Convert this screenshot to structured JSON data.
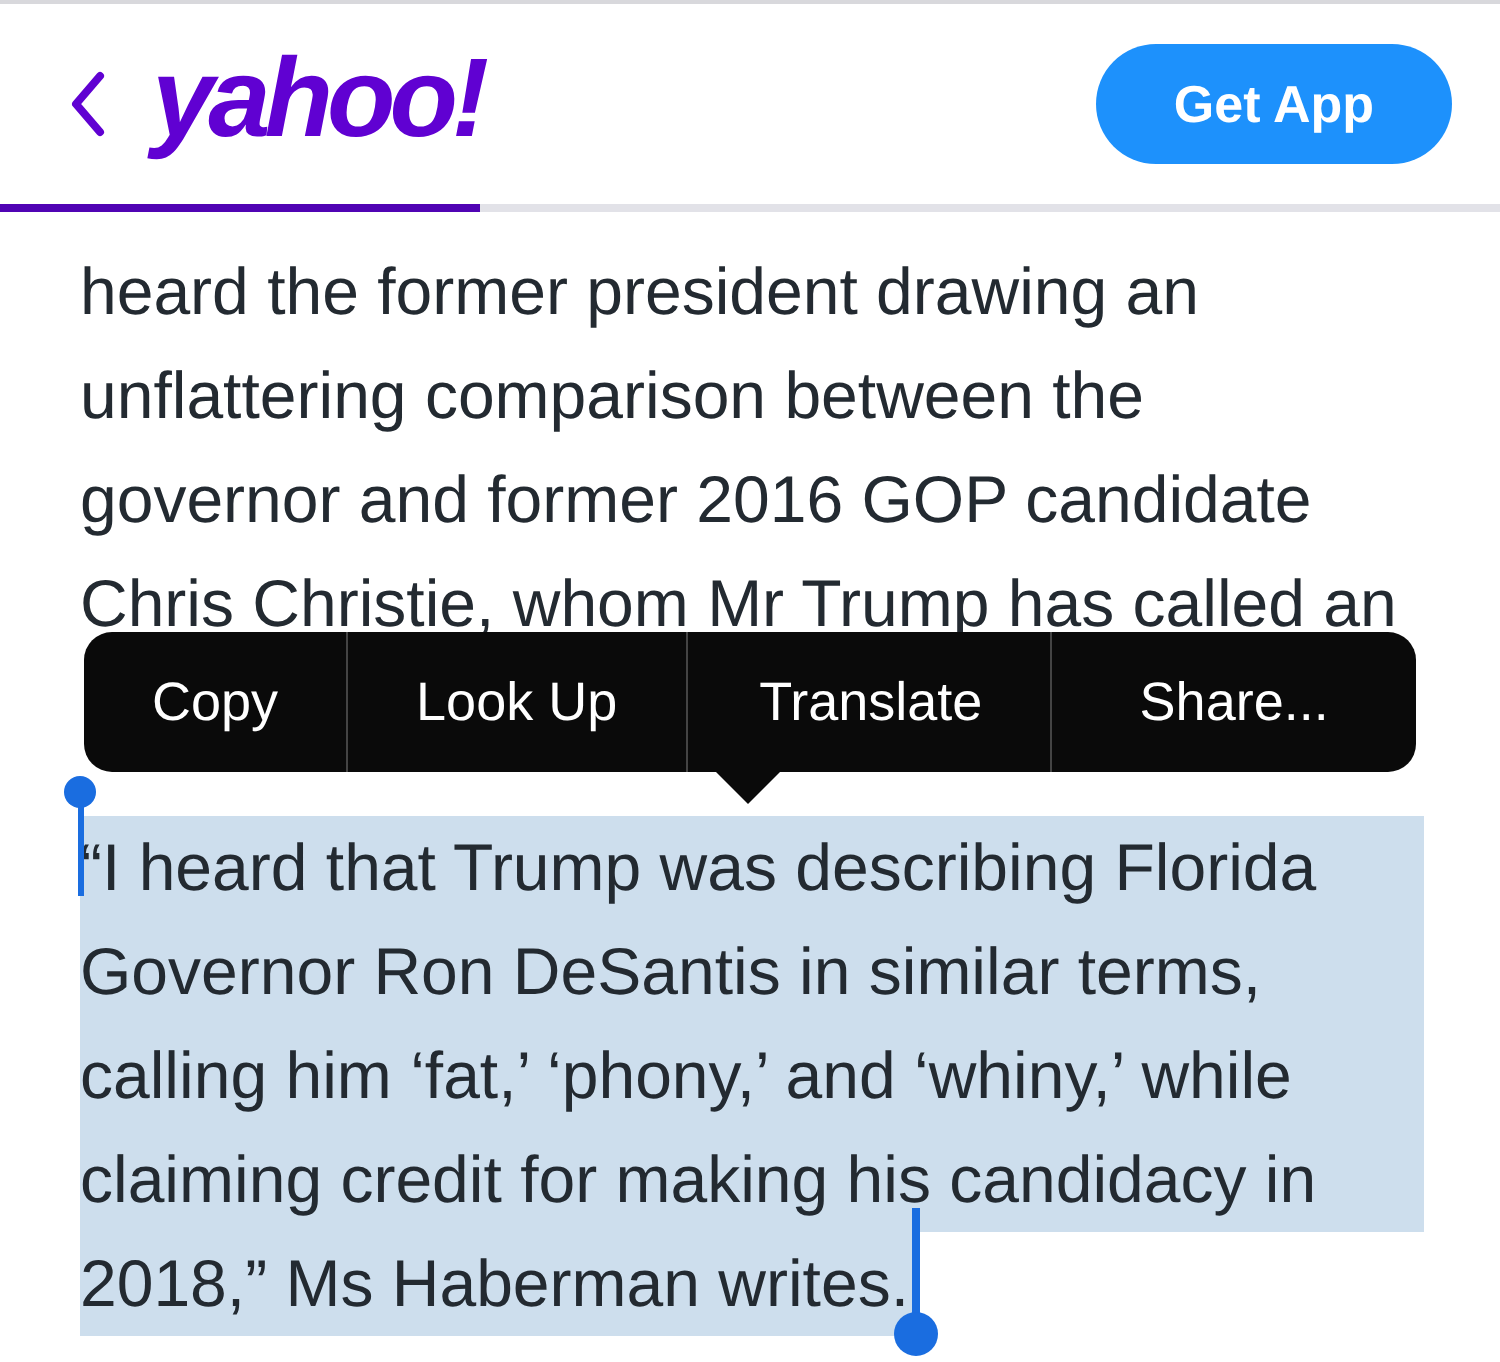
{
  "header": {
    "logo": "yahoo!",
    "button": "Get App"
  },
  "reading_progress": {
    "level": 0.32
  },
  "paragraphs": [
    {
      "text": "heard the former president drawing an unflattering comparison between the governor and former 2016 GOP candidate Chris Christie, whom Mr Trump has called an",
      "selected": false
    },
    {
      "text": "“I heard that Trump was describing Florida Governor Ron DeSantis in similar terms, calling him ‘fat,’ ‘phony,’ and ‘whiny,’ while claiming credit for making his candidacy in 2018,” Ms Haberman writes.",
      "selected": true
    }
  ],
  "context_menu": [
    "Copy",
    "Look Up",
    "Translate",
    "Share..."
  ]
}
